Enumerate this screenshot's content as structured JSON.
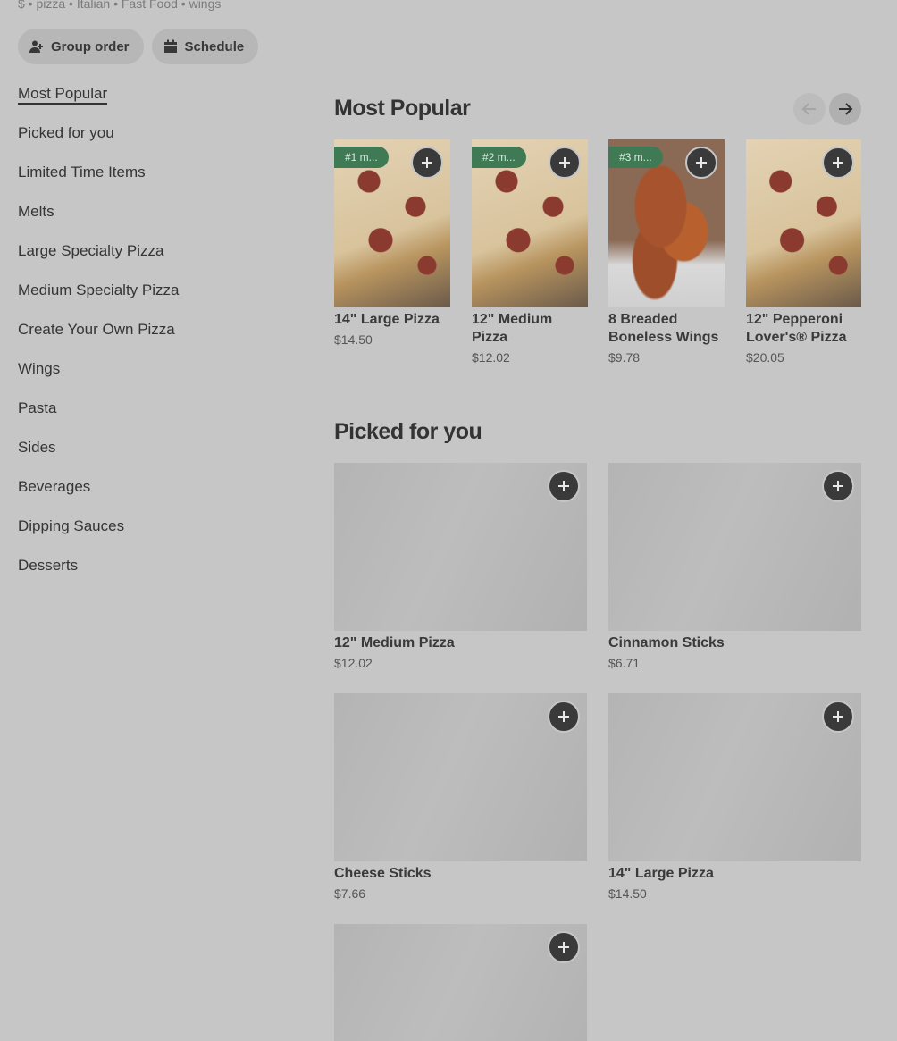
{
  "store": {
    "tagline": "$ • pizza • Italian • Fast Food • wings"
  },
  "actions": {
    "group_order": "Group order",
    "schedule": "Schedule"
  },
  "nav": [
    "Most Popular",
    "Picked for you",
    "Limited Time Items",
    "Melts",
    "Large Specialty Pizza",
    "Medium Specialty Pizza",
    "Create Your Own Pizza",
    "Wings",
    "Pasta",
    "Sides",
    "Beverages",
    "Dipping Sauces",
    "Desserts"
  ],
  "most_popular": {
    "title": "Most Popular",
    "items": [
      {
        "badge": "#1 m...",
        "name": "14\" Large Pizza",
        "price": "$14.50"
      },
      {
        "badge": "#2 m...",
        "name": "12\" Medium Pizza",
        "price": "$12.02"
      },
      {
        "badge": "#3 m...",
        "name": "8 Breaded Boneless Wings",
        "price": "$9.78"
      },
      {
        "badge": "",
        "name": "12\" Pepperoni Lover's® Pizza",
        "price": "$20.05"
      }
    ]
  },
  "picked_for_you": {
    "title": "Picked for you",
    "items": [
      {
        "name": "12\" Medium Pizza",
        "price": "$12.02"
      },
      {
        "name": "Cinnamon Sticks",
        "price": "$6.71"
      },
      {
        "name": "Cheese Sticks",
        "price": "$7.66"
      },
      {
        "name": "14\" Large Pizza",
        "price": "$14.50"
      },
      {
        "name": "",
        "price": ""
      }
    ]
  },
  "colors": {
    "background": "#c6c6c6",
    "badge": "#3f7a55",
    "add_button": "#3a3a3a"
  }
}
